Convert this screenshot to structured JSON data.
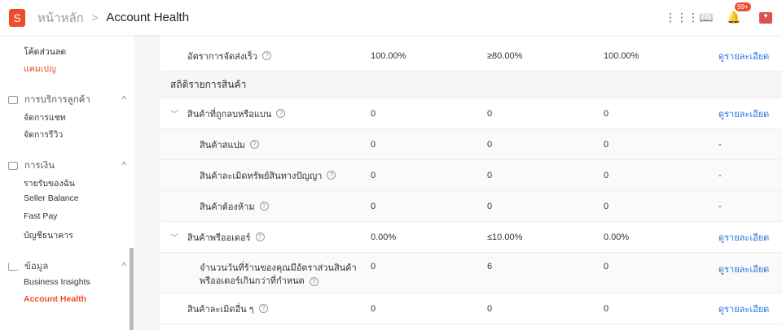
{
  "header": {
    "home": "หน้าหลัก",
    "current": "Account Health",
    "badge": "99+"
  },
  "sidebar": {
    "items_top": [
      {
        "label": "โค้ดส่วนลด"
      },
      {
        "label": "แคมเปญ"
      }
    ],
    "groups": [
      {
        "title": "การบริการลูกค้า",
        "items": [
          "จัดการแชท",
          "จัดการรีวิว"
        ]
      },
      {
        "title": "การเงิน",
        "items": [
          "รายรับของฉัน",
          "Seller Balance",
          "Fast Pay",
          "บัญชีธนาคาร"
        ]
      },
      {
        "title": "ข้อมูล",
        "items": [
          "Business Insights",
          "Account Health"
        ]
      }
    ]
  },
  "table": {
    "first_row": {
      "label": "อัตราการจัดส่งเร็ว",
      "v1": "100.00%",
      "v2": "≥80.00%",
      "v3": "100.00%",
      "action": "ดูรายละเอียด"
    },
    "section": "สถิติรายการสินค้า",
    "rows": [
      {
        "label": "สินค้าที่ถูกลบหรือแบน",
        "v1": "0",
        "v2": "0",
        "v3": "0",
        "action": "ดูรายละเอียด"
      },
      {
        "label": "สินค้าสแปม",
        "v1": "0",
        "v2": "0",
        "v3": "0",
        "action": "-"
      },
      {
        "label": "สินค้าละเมิดทรัพย์สินทางปัญญา",
        "v1": "0",
        "v2": "0",
        "v3": "0",
        "action": "-"
      },
      {
        "label": "สินค้าต้องห้าม",
        "v1": "0",
        "v2": "0",
        "v3": "0",
        "action": "-"
      },
      {
        "label": "สินค้าพรีออเดอร์",
        "v1": "0.00%",
        "v2": "≤10.00%",
        "v3": "0.00%",
        "action": "ดูรายละเอียด"
      },
      {
        "label": "จำนวนวันที่ร้านของคุณมีอัตราส่วนสินค้า",
        "label2": "พรีออเดอร์เกินกว่าที่กำหนด",
        "v1": "0",
        "v2": "6",
        "v3": "0",
        "action": "ดูรายละเอียด"
      },
      {
        "label": "สินค้าละเมิดอื่น ๆ",
        "v1": "0",
        "v2": "0",
        "v3": "0",
        "action": "ดูรายละเอียด"
      }
    ]
  }
}
